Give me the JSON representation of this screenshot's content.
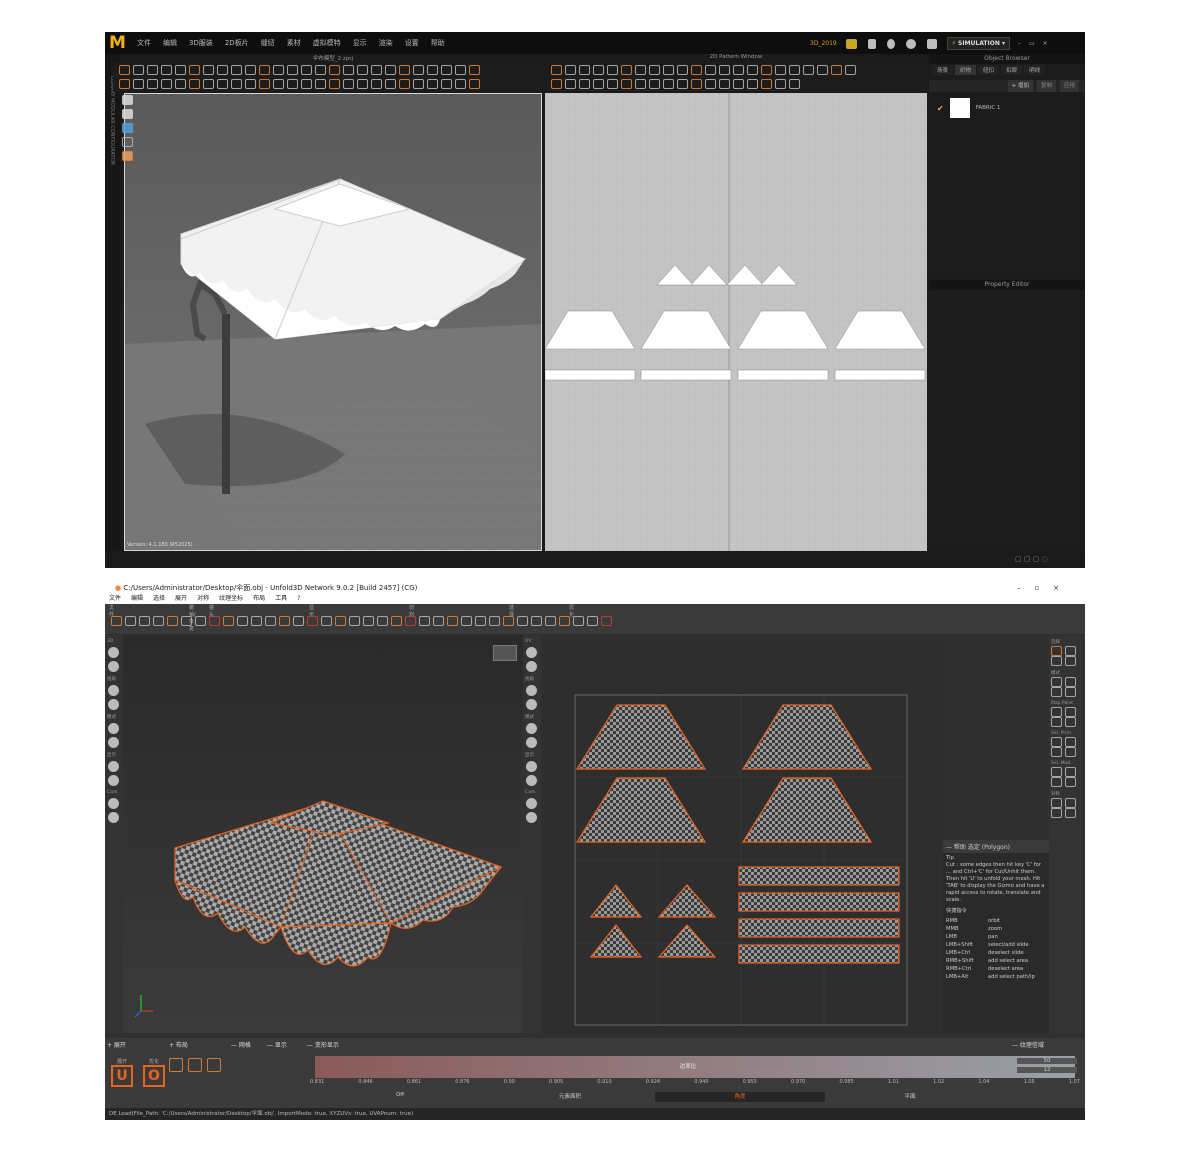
{
  "marvelous": {
    "menu": [
      "文件",
      "编辑",
      "3D服装",
      "2D板片",
      "缝纫",
      "素材",
      "虚拟模特",
      "显示",
      "渲染",
      "设置",
      "帮助"
    ],
    "project": "3D_2019",
    "mode": "SIMULATION",
    "viewport3d_title": "伞布模型_2.zprj",
    "viewport2d_title": "2D Pattern Window",
    "object_browser_title": "Object Browser",
    "object_browser_tabs": [
      "场景",
      "织物",
      "纽扣",
      "扣眼",
      "明线"
    ],
    "add_button": "+ 增加",
    "copy_button": "复制",
    "apply_button": "应用",
    "fabric_name": "FABRIC 1",
    "property_editor_title": "Property Editor",
    "left_strip": "LIBRARY   MODULAR CONFIGURATOR",
    "status_text": "Version: 4.1.180 (R52025)"
  },
  "unfold": {
    "title": "C:/Users/Administrator/Desktop/伞面.obj - Unfold3D Network 9.0.2 [Build 2457] (CG)",
    "menu": [
      "文件",
      "编辑",
      "选择",
      "展开",
      "对称",
      "纹理坐标",
      "布局",
      "工具",
      "?"
    ],
    "toolbar_sections": [
      "文件",
      "撤销/恢复",
      "镜头",
      "显示",
      "切割",
      "选择",
      "优化"
    ],
    "left_labels": [
      "3D",
      "视角",
      "模式",
      "显示",
      "Cam."
    ],
    "mid_labels": [
      "UV",
      "视角",
      "模式",
      "显示",
      "Cam."
    ],
    "right_labels": [
      "选择",
      "模式",
      "Map Paint",
      "Sel. Prim.",
      "Sel. Mod.",
      "对称"
    ],
    "help": {
      "header": "— 帮助 选定 (Polygon)",
      "tip_title": "Tip",
      "tip": "Cut : some edges then hit key 'C' for ... and Ctrl+'C' for Cut/Unhit them. Then hit 'U' to unfold your mesh. Hit 'TAB' to display the Gizmo and have a rapid access to rotate, translate and scale.",
      "shortcuts_title": "快捷指令",
      "shortcuts": [
        [
          "RMB",
          "orbit"
        ],
        [
          "MMB",
          "zoom"
        ],
        [
          "LMB",
          "pan"
        ],
        [
          "LMB+Shift",
          "select/add slide"
        ],
        [
          "LMB+Ctrl",
          "deselect slide"
        ],
        [
          "RMB+Shift",
          "add select area"
        ],
        [
          "RMB+Ctrl",
          "deselect area"
        ],
        [
          "LMB+Alt",
          "add select path/lp"
        ]
      ]
    },
    "bottom_sections": [
      "+ 展开",
      "+ 布局",
      "— 网格",
      "— 显示",
      "— 变形显示",
      "— 纹理信域"
    ],
    "unfold_labels": [
      "展开",
      "优化"
    ],
    "gradient_ticks": [
      "0.831",
      "0.846",
      "0.861",
      "0.876",
      "0.90",
      "0.905",
      "0.910",
      "0.924",
      "0.940",
      "0.955",
      "0.970",
      "0.985",
      "1.01",
      "1.02",
      "1.04",
      "1.05",
      "1.07"
    ],
    "gradient_label": "边率比",
    "mode_bar": [
      "Off",
      "元素面积",
      "角度",
      "平面"
    ],
    "texel_values": [
      "50",
      "12"
    ],
    "status": "DE.Load(File_Path: 'C:/Users/Administrator/Desktop/伞面.obj', ImportMode: true, XYZUVs: true, UVAPnum: true)"
  }
}
